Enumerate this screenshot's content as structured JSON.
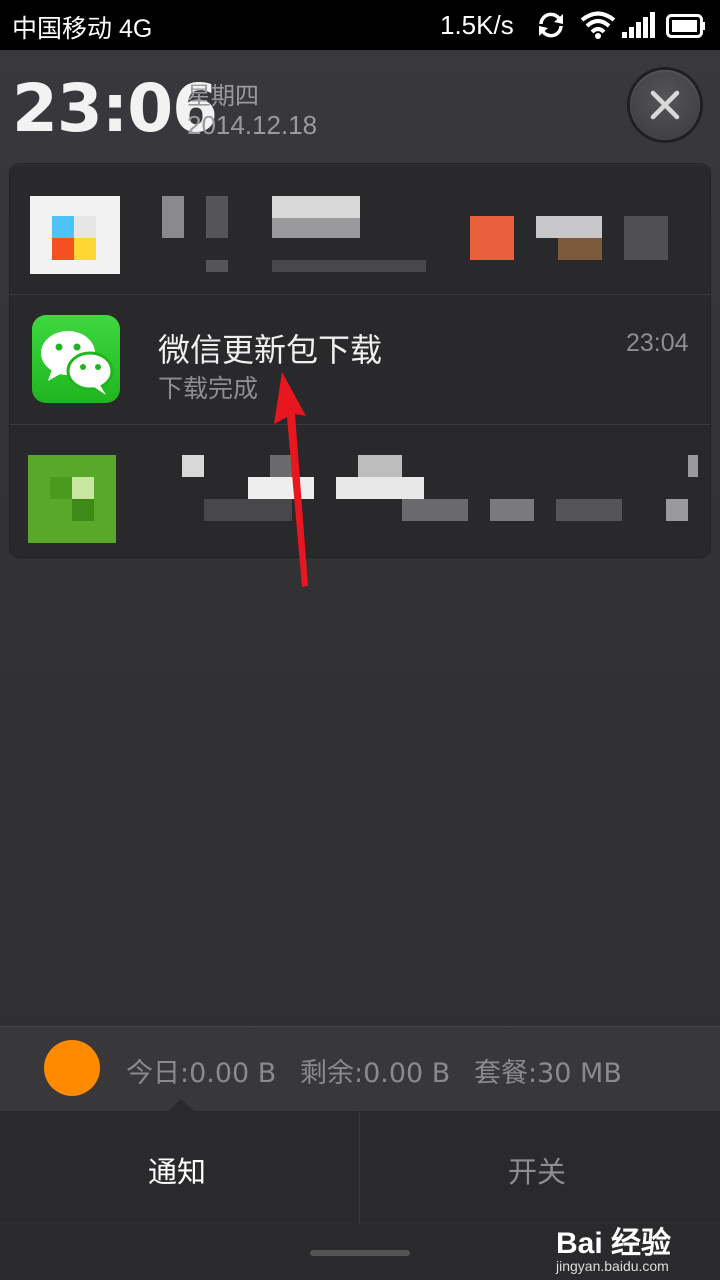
{
  "status_bar": {
    "carrier": "中国移动 4G",
    "net_speed": "1.5K/s",
    "icons": [
      "sync-icon",
      "wifi-icon",
      "signal-icon",
      "battery-icon"
    ]
  },
  "header": {
    "time": "23:06",
    "weekday": "星期四",
    "date": "2014.12.18"
  },
  "notifications": [
    {
      "app": "blurred",
      "content": "pixelated"
    },
    {
      "app": "wechat",
      "title": "微信更新包下载",
      "subtitle": "下载完成",
      "time": "23:04"
    },
    {
      "app": "blurred",
      "content": "pixelated"
    }
  ],
  "data_usage": {
    "today": "今日:0.00 B",
    "remaining": "剩余:0.00 B",
    "plan": "套餐:30 MB",
    "indicator_color": "#ff8a00"
  },
  "tabs": [
    {
      "label": "通知",
      "active": true
    },
    {
      "label": "开关",
      "active": false
    }
  ],
  "watermark": {
    "logo": "Bai 经验",
    "url": "jingyan.baidu.com"
  }
}
